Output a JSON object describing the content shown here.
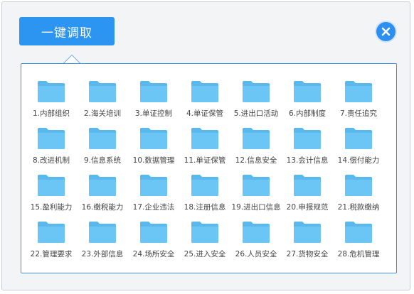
{
  "toolbar": {
    "fetch_label": "一键调取"
  },
  "colors": {
    "accent": "#2c95f2",
    "folder": "#6cc6f5",
    "panel_border": "#3c8fe8"
  },
  "icons": {
    "close": "close-icon",
    "folder": "folder-icon"
  },
  "folders": [
    "1.内部组织",
    "2.海关培训",
    "3.单证控制",
    "4.单证保管",
    "5.进出口活动",
    "6.内部制度",
    "7.责任追究",
    "8.改进机制",
    "9.信息系统",
    "10.数据管理",
    "11.单证保管",
    "12.信息安全",
    "13.会计信息",
    "14.偿付能力",
    "15.盈利能力",
    "16.缴税能力",
    "17.企业违法",
    "18.注册信息",
    "19.进出口信息",
    "20.申报规范",
    "21.税款缴纳",
    "22.管理要求",
    "23.外部信息",
    "24.场所安全",
    "25.进入安全",
    "26.人员安全",
    "27.货物安全",
    "28.危机管理"
  ]
}
